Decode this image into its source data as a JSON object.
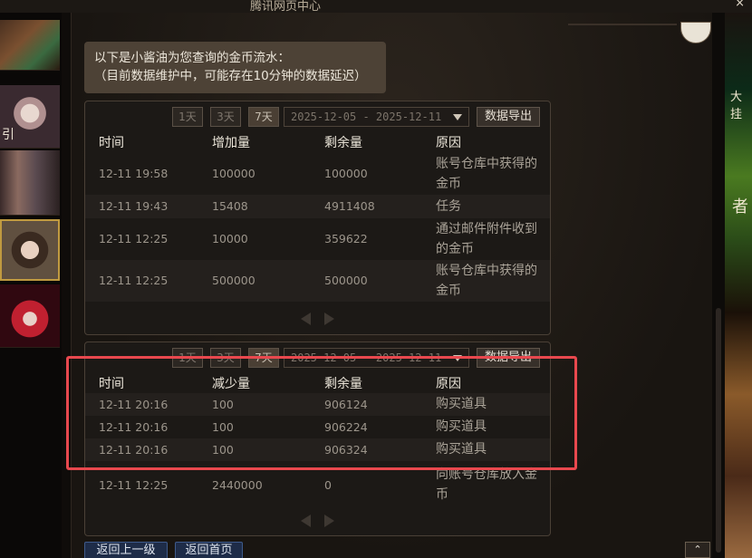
{
  "window": {
    "title": "腾讯网页中心",
    "close": "×"
  },
  "side": {
    "label": "引"
  },
  "right_side": {
    "label1": "大挂",
    "label2": "者"
  },
  "notice": {
    "line1": "以下是小酱油为您查询的金币流水：",
    "line2": "（目前数据维护中，可能存在10分钟的数据延迟）"
  },
  "panel1": {
    "btn_1day": "1天",
    "btn_3day": "3天",
    "btn_7day": "7天",
    "date_range": "2025-12-05  - 2025-12-11",
    "export": "数据导出",
    "headers": [
      "时间",
      "增加量",
      "剩余量",
      "原因"
    ],
    "rows": [
      {
        "time": "12-11 19:58",
        "amount": "100000",
        "remaining": "100000",
        "reason": "账号仓库中获得的金币"
      },
      {
        "time": "12-11 19:43",
        "amount": "15408",
        "remaining": "4911408",
        "reason": "任务"
      },
      {
        "time": "12-11 12:25",
        "amount": "10000",
        "remaining": "359622",
        "reason": "通过邮件附件收到的金币"
      },
      {
        "time": "12-11 12:25",
        "amount": "500000",
        "remaining": "500000",
        "reason": "账号仓库中获得的金币"
      }
    ]
  },
  "panel2": {
    "btn_1day": "1天",
    "btn_3day": "3天",
    "btn_7day": "7天",
    "date_range": "2025-12-05  - 2025-12-11",
    "export": "数据导出",
    "headers": [
      "时间",
      "减少量",
      "剩余量",
      "原因"
    ],
    "rows": [
      {
        "time": "12-11 20:16",
        "amount": "100",
        "remaining": "906124",
        "reason": "购买道具"
      },
      {
        "time": "12-11 20:16",
        "amount": "100",
        "remaining": "906224",
        "reason": "购买道具"
      },
      {
        "time": "12-11 20:16",
        "amount": "100",
        "remaining": "906324",
        "reason": "购买道具"
      },
      {
        "time": "12-11 12:25",
        "amount": "2440000",
        "remaining": "0",
        "reason": "向账号仓库放入金币"
      }
    ]
  },
  "footer": {
    "back": "返回上一级",
    "home": "返回首页",
    "scroll_top": "⌃"
  },
  "colors": {
    "highlight": "#e8484e",
    "panel_bg": "#1c1916",
    "button_blue": "#1e2c48"
  }
}
